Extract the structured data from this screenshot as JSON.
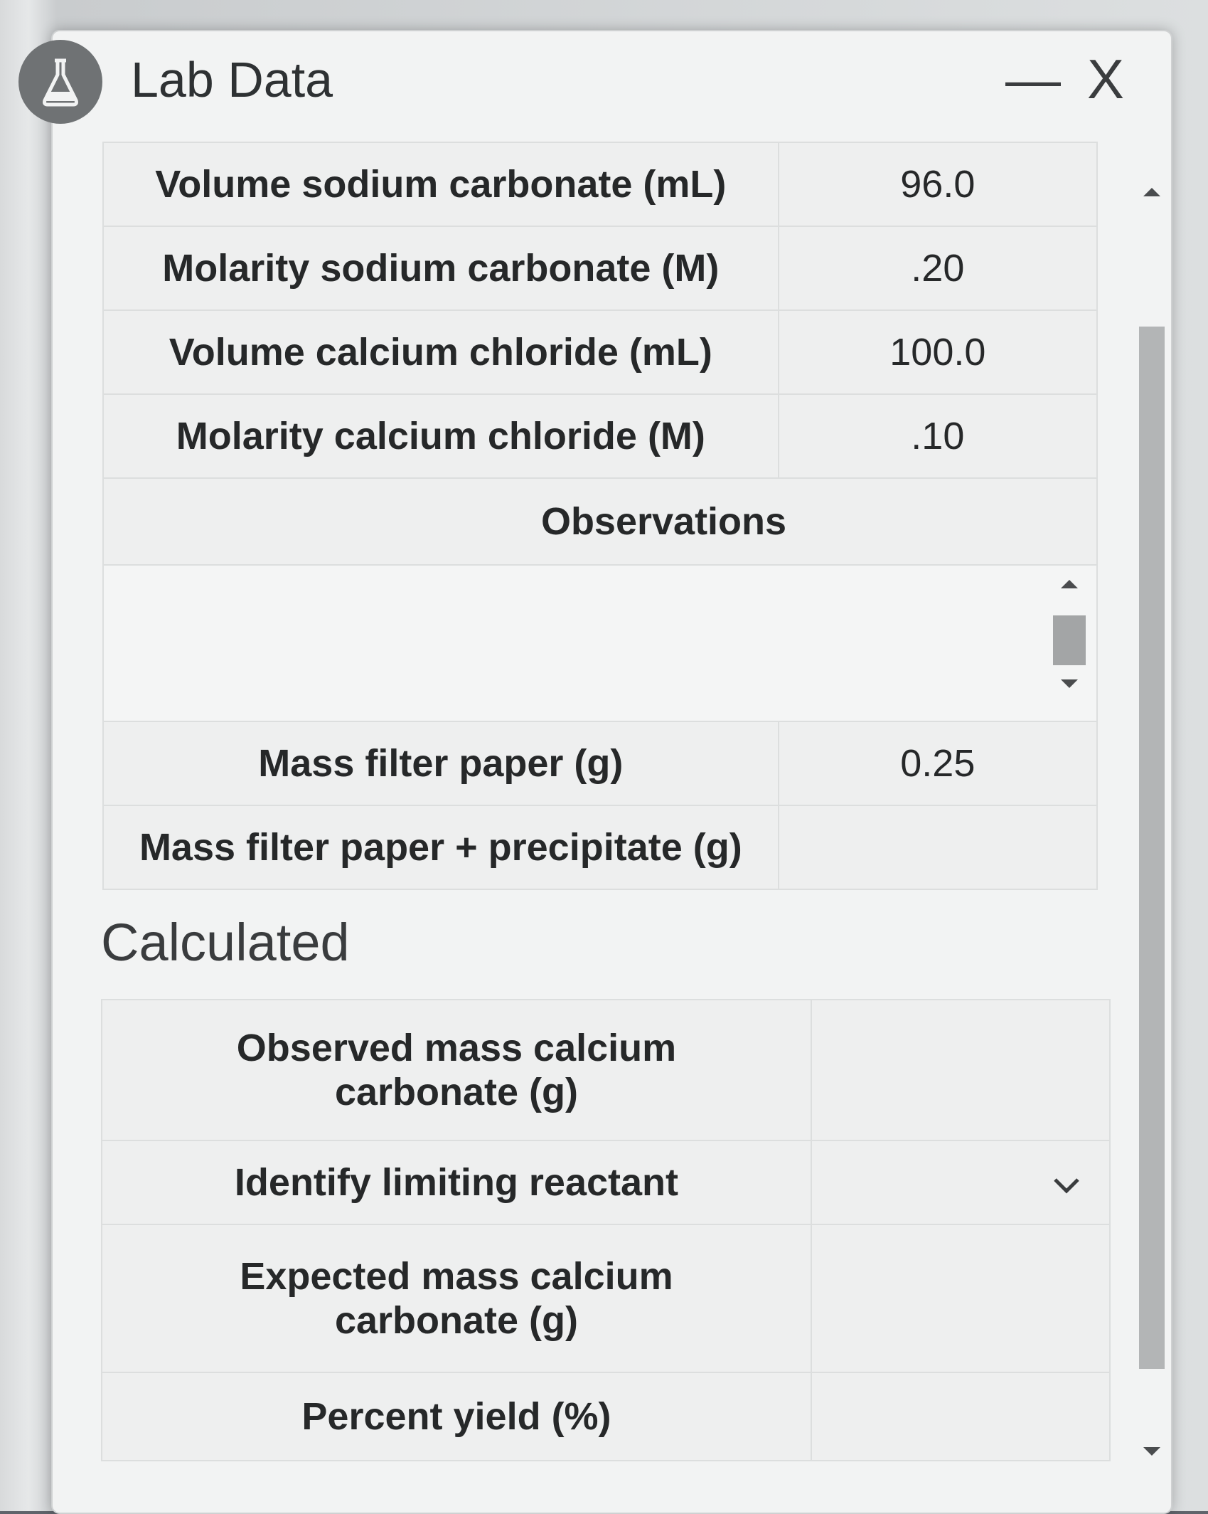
{
  "window": {
    "title": "Lab Data",
    "minimize_label": "—",
    "close_label": "X"
  },
  "data_rows": [
    {
      "label": "Volume sodium carbonate (mL)",
      "value": "96.0"
    },
    {
      "label": "Molarity sodium carbonate (M)",
      "value": ".20"
    },
    {
      "label": "Volume calcium chloride (mL)",
      "value": "100.0"
    },
    {
      "label": "Molarity calcium chloride (M)",
      "value": ".10"
    }
  ],
  "observations": {
    "label": "Observations",
    "value": ""
  },
  "mass_rows": [
    {
      "label": "Mass filter paper (g)",
      "value": "0.25"
    },
    {
      "label": "Mass filter paper + precipitate (g)",
      "value": ""
    }
  ],
  "calculated": {
    "heading": "Calculated",
    "rows": [
      {
        "label": "Observed mass calcium carbonate (g)",
        "value": ""
      },
      {
        "label": "Identify limiting reactant",
        "value": ""
      },
      {
        "label": "Expected mass calcium carbonate (g)",
        "value": ""
      },
      {
        "label": "Percent yield (%)",
        "value": ""
      }
    ]
  },
  "icons": {
    "badge": "flask-icon",
    "dropdown": "chevron-down-icon"
  },
  "colors": {
    "panel_bg": "#f2f3f3",
    "cell_border": "#dcdede",
    "scroll_thumb": "#b3b5b6"
  }
}
